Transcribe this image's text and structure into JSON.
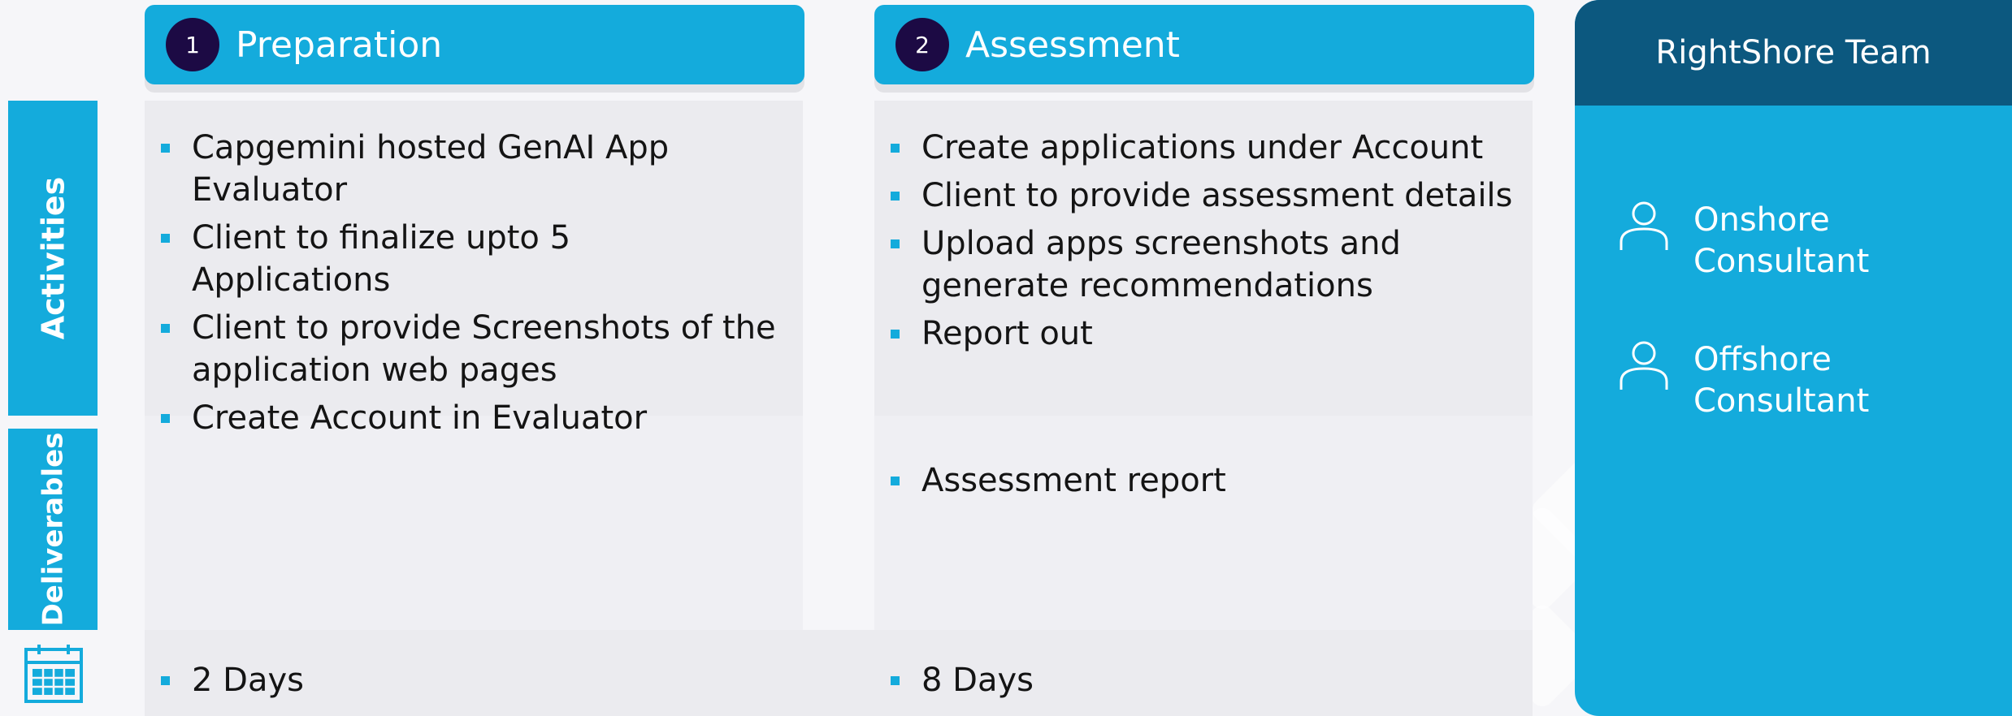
{
  "phases": [
    {
      "num": "1",
      "title": "Preparation"
    },
    {
      "num": "2",
      "title": "Assessment"
    }
  ],
  "rows": {
    "activities_label": "Activities",
    "deliverables_label": "Deliverables",
    "timeline_icon": "calendar-icon"
  },
  "preparation": {
    "activities": [
      "Capgemini hosted GenAI App Evaluator",
      "Client to finalize upto 5 Applications",
      "Client to provide Screenshots of the application web pages",
      "Create Account in Evaluator"
    ],
    "duration": "2 Days"
  },
  "assessment": {
    "activities": [
      "Create applications under Account",
      "Client to provide assessment details",
      "Upload apps screenshots and generate recommendations",
      "Report out"
    ],
    "deliverables": [
      "Assessment report"
    ],
    "duration": "8 Days"
  },
  "team": {
    "title": "RightShore Team",
    "members": [
      {
        "name": "Onshore Consultant",
        "icon": "person-icon"
      },
      {
        "name": "Offshore Consultant",
        "icon": "person-icon"
      }
    ]
  },
  "colors": {
    "accent": "#14abdc",
    "dark_navy": "#1c0a44",
    "team_header": "#0c587f"
  }
}
